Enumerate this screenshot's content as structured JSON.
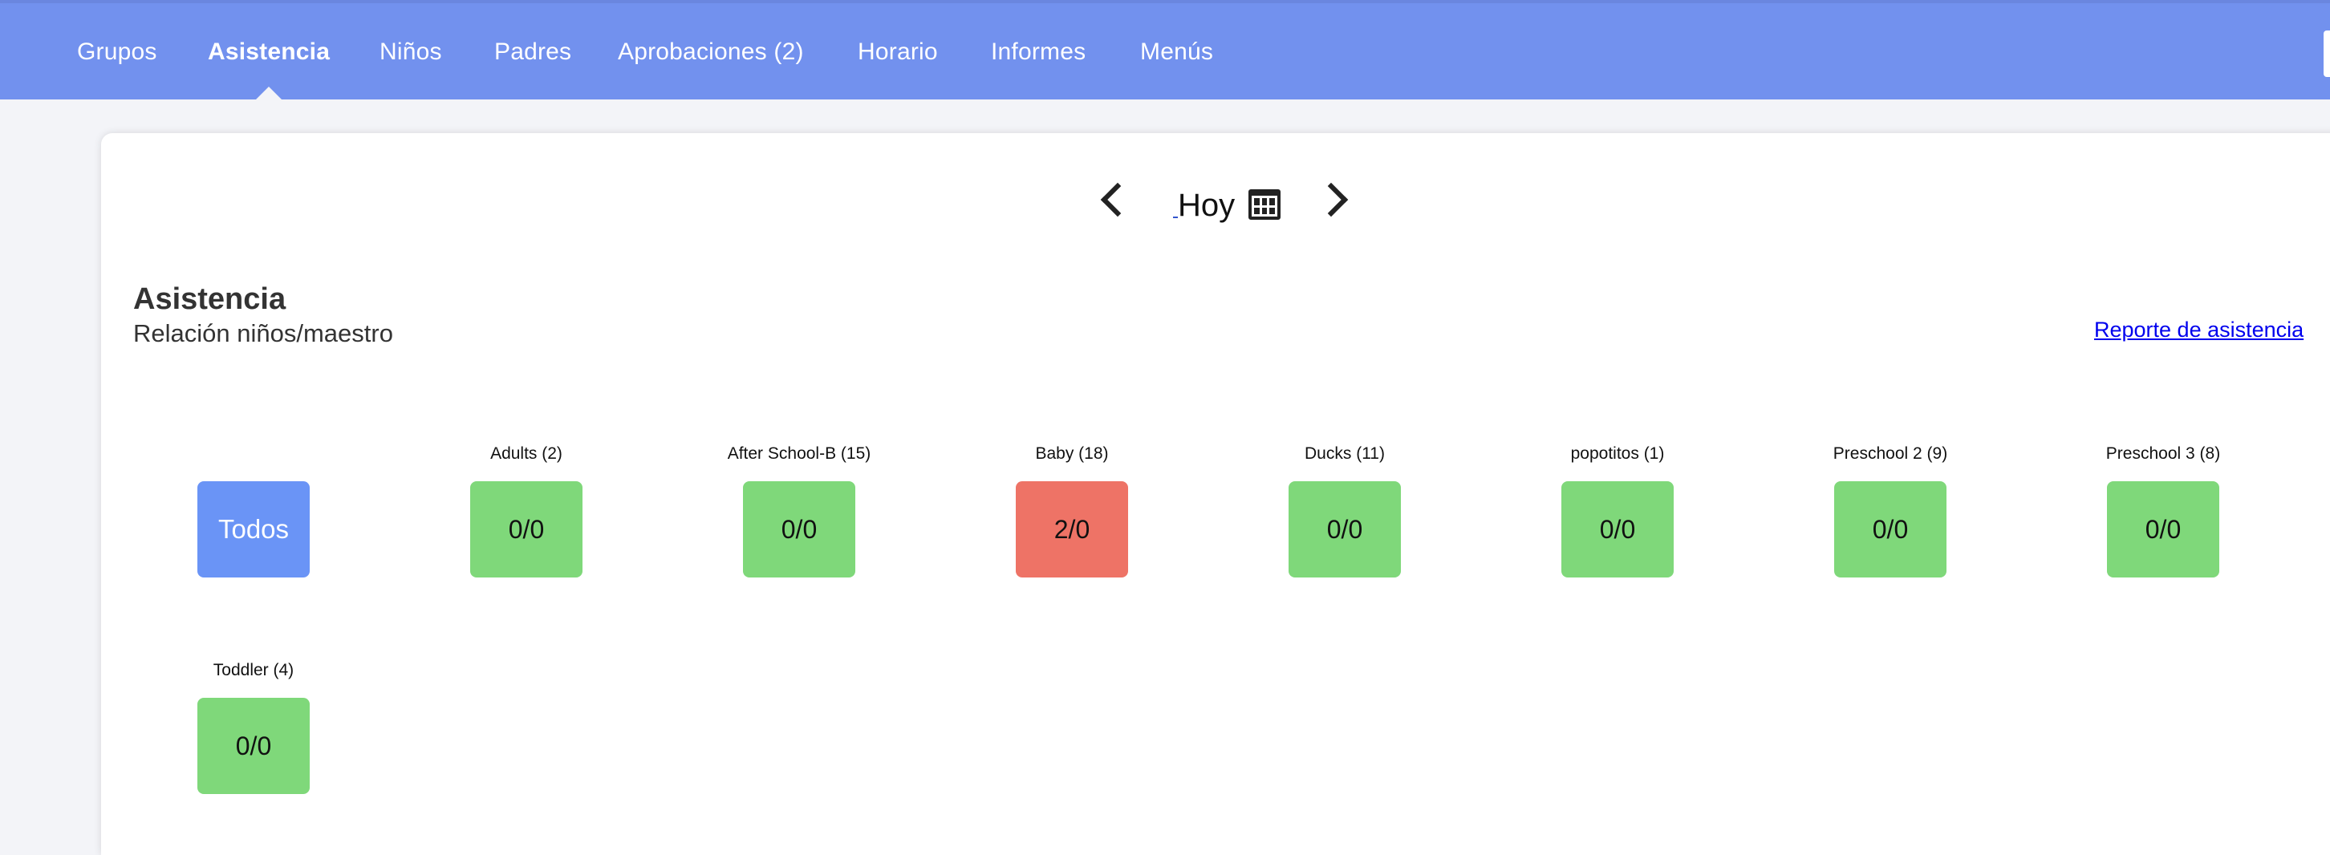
{
  "nav": {
    "items": [
      {
        "label": "Grupos"
      },
      {
        "label": "Asistencia"
      },
      {
        "label": "Niños"
      },
      {
        "label": "Padres"
      },
      {
        "label": "Aprobaciones (2)"
      },
      {
        "label": "Horario"
      },
      {
        "label": "Informes"
      },
      {
        "label": "Menús"
      }
    ],
    "active": "Asistencia",
    "color": "#7291ee"
  },
  "date_nav": {
    "label": "Hoy"
  },
  "section": {
    "title": "Asistencia",
    "subtitle": "Relación niños/maestro",
    "report_link": "Reporte de asistencia"
  },
  "all_button": {
    "label": "Todos",
    "color": "#6a94f6"
  },
  "groups": [
    {
      "label": "Adults (2)",
      "ratio": "0/0",
      "status": "ok"
    },
    {
      "label": "After School-B (15)",
      "ratio": "0/0",
      "status": "ok"
    },
    {
      "label": "Baby (18)",
      "ratio": "2/0",
      "status": "alert"
    },
    {
      "label": "Ducks (11)",
      "ratio": "0/0",
      "status": "ok"
    },
    {
      "label": "popotitos (1)",
      "ratio": "0/0",
      "status": "ok"
    },
    {
      "label": "Preschool 2 (9)",
      "ratio": "0/0",
      "status": "ok"
    },
    {
      "label": "Preschool 3 (8)",
      "ratio": "0/0",
      "status": "ok"
    },
    {
      "label": "Toddler (4)",
      "ratio": "0/0",
      "status": "ok"
    }
  ],
  "status_colors": {
    "ok": "#7fd87a",
    "alert": "#ee7366"
  },
  "icons": {
    "prev": "chevron-left-icon",
    "next": "chevron-right-icon",
    "calendar": "calendar-icon"
  }
}
